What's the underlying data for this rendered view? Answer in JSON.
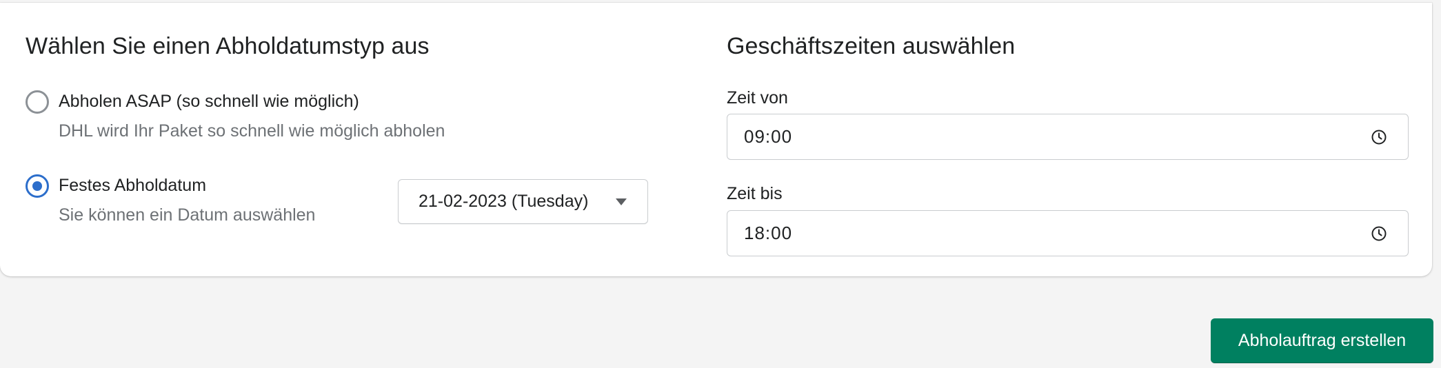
{
  "pickup_type": {
    "title": "Wählen Sie einen Abholdatumstyp aus",
    "options": [
      {
        "label": "Abholen ASAP (so schnell wie möglich)",
        "help": "DHL wird Ihr Paket so schnell wie möglich abholen",
        "checked": false
      },
      {
        "label": "Festes Abholdatum",
        "help": "Sie können ein Datum auswählen",
        "checked": true
      }
    ],
    "date_select": {
      "value": "21-02-2023 (Tuesday)",
      "icon": "caret-down-icon"
    }
  },
  "business_hours": {
    "title": "Geschäftszeiten auswählen",
    "from": {
      "label": "Zeit von",
      "value": "09:00",
      "icon": "clock-icon"
    },
    "to": {
      "label": "Zeit bis",
      "value": "18:00",
      "icon": "clock-icon"
    }
  },
  "actions": {
    "submit_label": "Abholauftrag erstellen"
  },
  "colors": {
    "primary": "#008060",
    "radio_selected": "#2c6ecb",
    "page_background": "#f4f4f4"
  }
}
